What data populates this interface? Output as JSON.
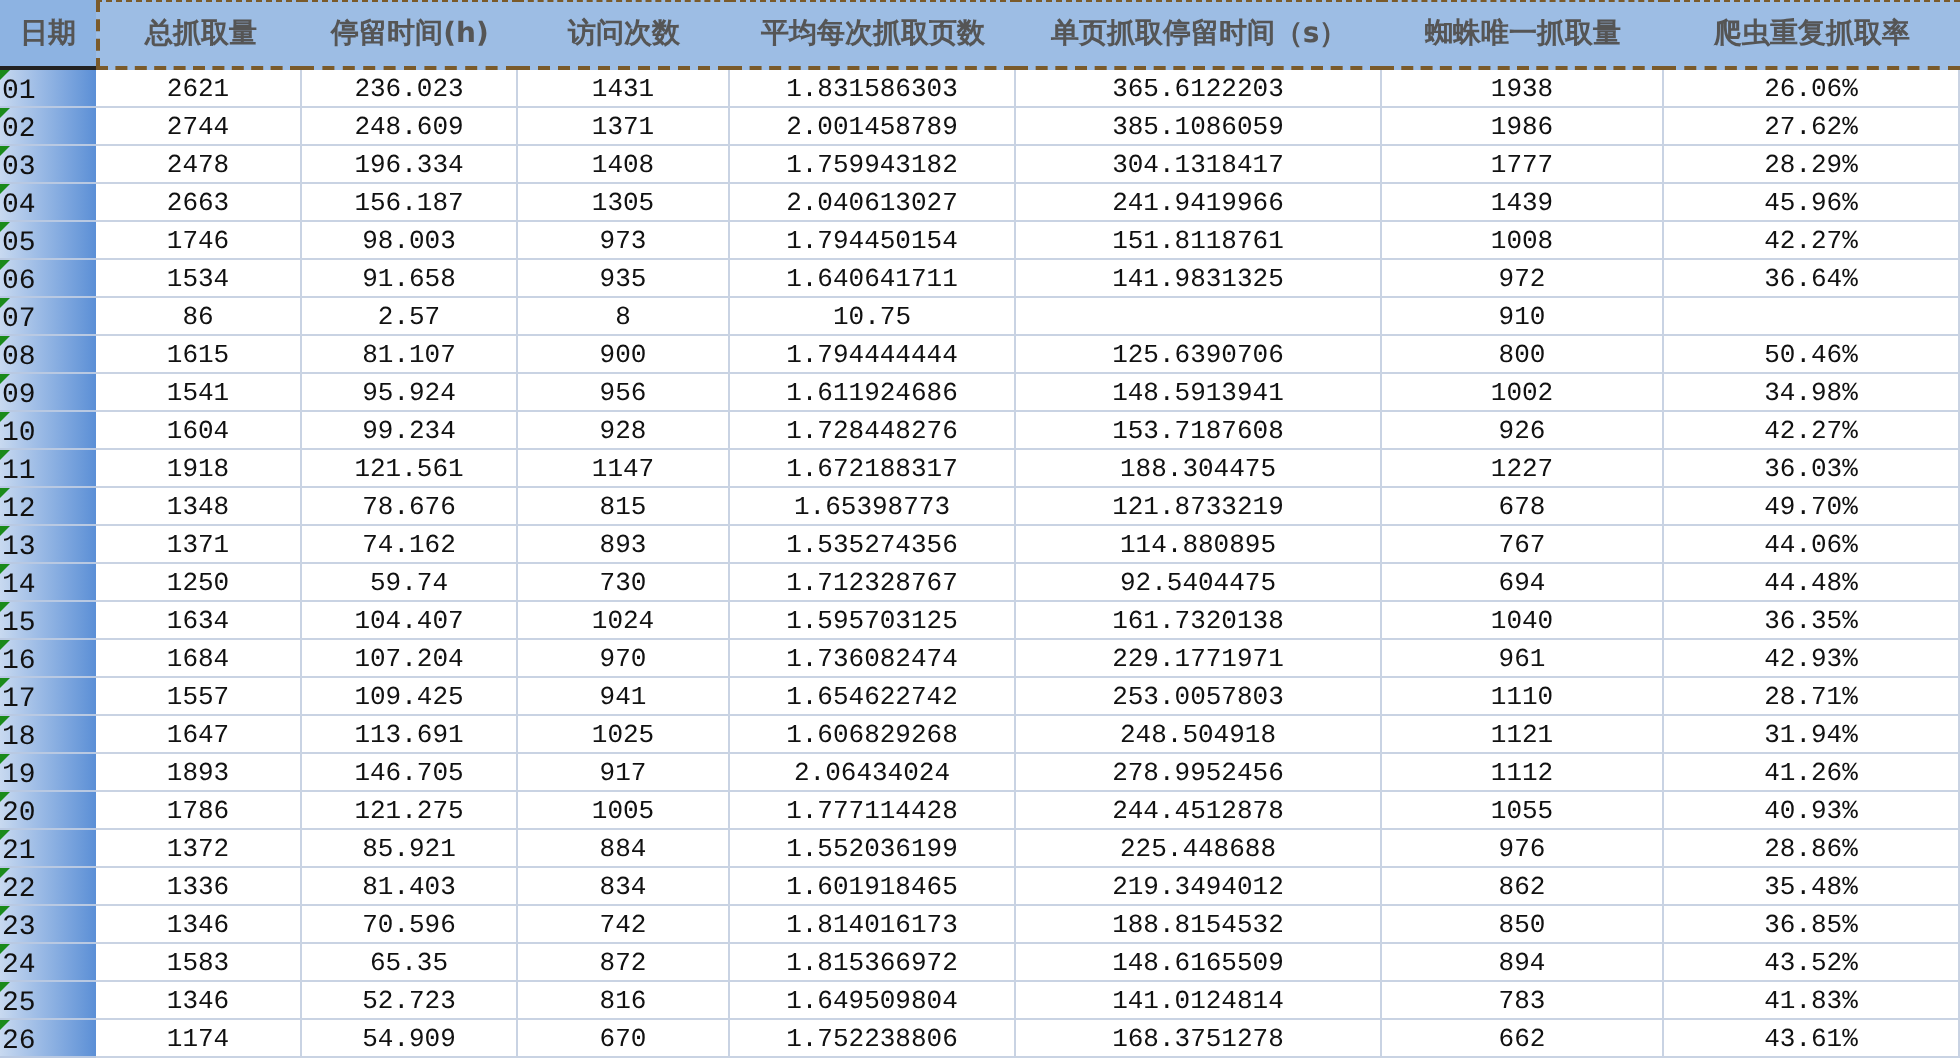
{
  "table": {
    "columns": [
      "日期",
      "总抓取量",
      "停留时间(h)",
      "访问次数",
      "平均每次抓取页数",
      "单页抓取停留时间（s）",
      "蜘蛛唯一抓取量",
      "爬虫重复抓取率"
    ],
    "rows": [
      {
        "cells": [
          "01",
          "2621",
          "236.023",
          "1431",
          "1.831586303",
          "365.6122203",
          "1938",
          "26.06%"
        ]
      },
      {
        "cells": [
          "02",
          "2744",
          "248.609",
          "1371",
          "2.001458789",
          "385.1086059",
          "1986",
          "27.62%"
        ]
      },
      {
        "cells": [
          "03",
          "2478",
          "196.334",
          "1408",
          "1.759943182",
          "304.1318417",
          "1777",
          "28.29%"
        ]
      },
      {
        "cells": [
          "04",
          "2663",
          "156.187",
          "1305",
          "2.040613027",
          "241.9419966",
          "1439",
          "45.96%"
        ]
      },
      {
        "cells": [
          "05",
          "1746",
          "98.003",
          "973",
          "1.794450154",
          "151.8118761",
          "1008",
          "42.27%"
        ]
      },
      {
        "cells": [
          "06",
          "1534",
          "91.658",
          "935",
          "1.640641711",
          "141.9831325",
          "972",
          "36.64%"
        ]
      },
      {
        "cells": [
          "07",
          "86",
          "2.57",
          "8",
          "10.75",
          "",
          "910",
          ""
        ]
      },
      {
        "cells": [
          "08",
          "1615",
          "81.107",
          "900",
          "1.794444444",
          "125.6390706",
          "800",
          "50.46%"
        ]
      },
      {
        "cells": [
          "09",
          "1541",
          "95.924",
          "956",
          "1.611924686",
          "148.5913941",
          "1002",
          "34.98%"
        ]
      },
      {
        "cells": [
          "10",
          "1604",
          "99.234",
          "928",
          "1.728448276",
          "153.7187608",
          "926",
          "42.27%"
        ]
      },
      {
        "cells": [
          "11",
          "1918",
          "121.561",
          "1147",
          "1.672188317",
          "188.304475",
          "1227",
          "36.03%"
        ]
      },
      {
        "cells": [
          "12",
          "1348",
          "78.676",
          "815",
          "1.65398773",
          "121.8733219",
          "678",
          "49.70%"
        ]
      },
      {
        "cells": [
          "13",
          "1371",
          "74.162",
          "893",
          "1.535274356",
          "114.880895",
          "767",
          "44.06%"
        ]
      },
      {
        "cells": [
          "14",
          "1250",
          "59.74",
          "730",
          "1.712328767",
          "92.5404475",
          "694",
          "44.48%"
        ]
      },
      {
        "cells": [
          "15",
          "1634",
          "104.407",
          "1024",
          "1.595703125",
          "161.7320138",
          "1040",
          "36.35%"
        ]
      },
      {
        "cells": [
          "16",
          "1684",
          "107.204",
          "970",
          "1.736082474",
          "229.1771971",
          "961",
          "42.93%"
        ]
      },
      {
        "cells": [
          "17",
          "1557",
          "109.425",
          "941",
          "1.654622742",
          "253.0057803",
          "1110",
          "28.71%"
        ]
      },
      {
        "cells": [
          "18",
          "1647",
          "113.691",
          "1025",
          "1.606829268",
          "248.504918",
          "1121",
          "31.94%"
        ]
      },
      {
        "cells": [
          "19",
          "1893",
          "146.705",
          "917",
          "2.06434024",
          "278.9952456",
          "1112",
          "41.26%"
        ]
      },
      {
        "cells": [
          "20",
          "1786",
          "121.275",
          "1005",
          "1.777114428",
          "244.4512878",
          "1055",
          "40.93%"
        ]
      },
      {
        "cells": [
          "21",
          "1372",
          "85.921",
          "884",
          "1.552036199",
          "225.448688",
          "976",
          "28.86%"
        ]
      },
      {
        "cells": [
          "22",
          "1336",
          "81.403",
          "834",
          "1.601918465",
          "219.3494012",
          "862",
          "35.48%"
        ]
      },
      {
        "cells": [
          "23",
          "1346",
          "70.596",
          "742",
          "1.814016173",
          "188.8154532",
          "850",
          "36.85%"
        ]
      },
      {
        "cells": [
          "24",
          "1583",
          "65.35",
          "872",
          "1.815366972",
          "148.6165509",
          "894",
          "43.52%"
        ]
      },
      {
        "cells": [
          "25",
          "1346",
          "52.723",
          "816",
          "1.649509804",
          "141.0124814",
          "783",
          "41.83%"
        ]
      },
      {
        "cells": [
          "26",
          "1174",
          "54.909",
          "670",
          "1.752238806",
          "168.3751278",
          "662",
          "43.61%"
        ]
      }
    ]
  }
}
